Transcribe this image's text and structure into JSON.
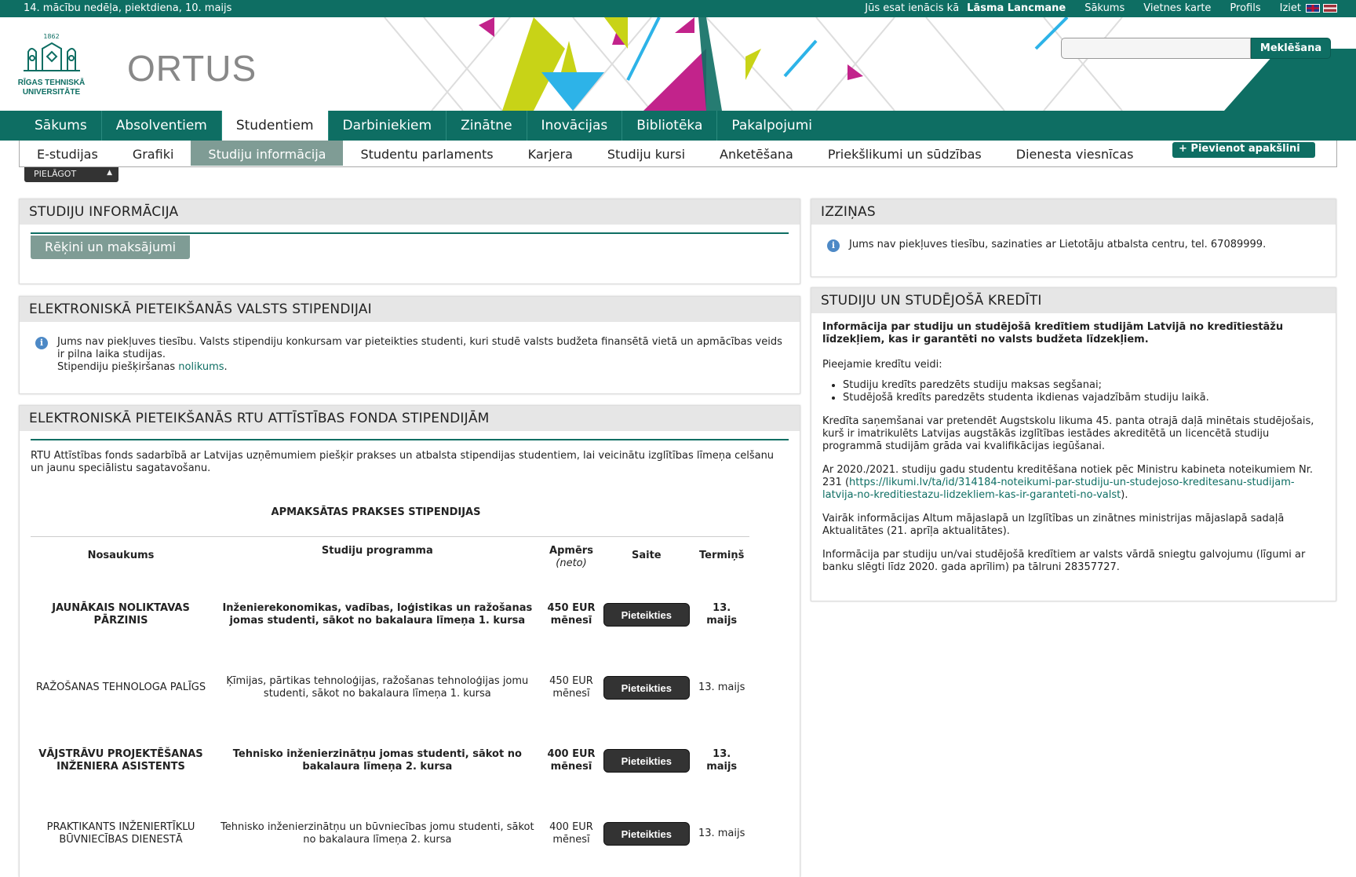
{
  "topbar": {
    "week_info": "14. mācību nedēļa, piektdiena, 10. maijs",
    "logged_in_prefix": "Jūs esat ienācis kā",
    "user_name": "Lāsma Lancmane",
    "links": [
      "Sākums",
      "Vietnes karte",
      "Profils",
      "Iziet"
    ]
  },
  "header": {
    "logo_year": "1862",
    "logo_name_line1": "RĪGAS TEHNISKĀ",
    "logo_name_line2": "UNIVERSITĀTE",
    "portal_name": "ORTUS",
    "search_placeholder": "",
    "search_button": "Meklēšana"
  },
  "main_nav": [
    "Sākums",
    "Absolventiem",
    "Studentiem",
    "Darbiniekiem",
    "Zinātne",
    "Inovācijas",
    "Bibliotēka",
    "Pakalpojumi"
  ],
  "main_nav_active": "Studentiem",
  "sub_nav": [
    "E-studijas",
    "Grafiki",
    "Studiju informācija",
    "Studentu parlaments",
    "Karjera",
    "Studiju kursi",
    "Anketēšana",
    "Priekšlikumi un sūdzības",
    "Dienesta viesnīcas"
  ],
  "sub_nav_active": "Studiju informācija",
  "add_sublink_label": "Pievienot apakšlini",
  "customize_label": "PIELĀGOT",
  "panel_study_info": {
    "title": "STUDIJU INFORMĀCIJA",
    "button": "Rēķini un maksājumi"
  },
  "panel_state_scholarship": {
    "title": "ELEKTRONISKĀ PIETEIKŠANĀS VALSTS STIPENDIJAI",
    "text": "Jums nav piekļuves tiesību. Valsts stipendiju konkursam var pieteikties studenti, kuri studē valsts budžeta finansētā vietā un apmācības veids ir pilna laika studijas.",
    "rules_prefix": "Stipendiju piešķiršanas",
    "rules_link": "nolikums",
    "rules_suffix": "."
  },
  "panel_rtu_fund": {
    "title": "ELEKTRONISKĀ PIETEIKŠANĀS RTU ATTĪSTĪBAS FONDA STIPENDIJĀM",
    "intro": "RTU Attīstības fonds sadarbībā ar Latvijas uzņēmumiem piešķir prakses un atbalsta stipendijas studentiem, lai veicinātu izglītības līmeņa celšanu un jaunu speciālistu sagatavošanu.",
    "table_title": "APMAKSĀTAS PRAKSES STIPENDIJAS",
    "columns": {
      "name": "Nosaukums",
      "program": "Studiju programma",
      "amount_line1": "Apmērs",
      "amount_line2": "(neto)",
      "link": "Saite",
      "deadline": "Termiņš"
    },
    "rows": [
      {
        "name": "JAUNĀKAIS NOLIKTAVAS PĀRZINIS",
        "program": "Inženierekonomikas, vadības, loģistikas un ražošanas jomas studenti, sākot no bakalaura līmeņa 1. kursa",
        "amount": "450 EUR mēnesī",
        "button": "Pieteikties",
        "deadline": "13. maijs",
        "bold": true
      },
      {
        "name": "RAŽOŠANAS TEHNOLOGA PALĪGS",
        "program": "Ķīmijas, pārtikas tehnoloģijas, ražošanas tehnoloģijas jomu studenti, sākot no bakalaura līmeņa 1. kursa",
        "amount": "450 EUR mēnesī",
        "button": "Pieteikties",
        "deadline": "13. maijs",
        "bold": false
      },
      {
        "name": "VĀJSTRĀVU PROJEKTĒŠANAS INŽENIERA ASISTENTS",
        "program": "Tehnisko inženierzinātņu jomas studenti, sākot no bakalaura līmeņa 2. kursa",
        "amount": "400 EUR mēnesī",
        "button": "Pieteikties",
        "deadline": "13. maijs",
        "bold": true
      },
      {
        "name": "PRAKTIKANTS INŽENIERTĪKLU BŪVNIECĪBAS DIENESTĀ",
        "program": "Tehnisko inženierzinātņu un būvniecības jomu studenti, sākot no bakalaura līmeņa 2. kursa",
        "amount": "400 EUR mēnesī",
        "button": "Pieteikties",
        "deadline": "13. maijs",
        "bold": false
      }
    ]
  },
  "panel_certificates": {
    "title": "IZZIŅAS",
    "text": "Jums nav piekļuves tiesību, sazinaties ar Lietotāju atbalsta centru, tel. 67089999."
  },
  "panel_loans": {
    "title": "STUDIJU UN STUDĒJOŠĀ KREDĪTI",
    "lead": "Informācija par studiju un studējošā kredītiem studijām Latvijā no kredītiestāžu līdzekļiem, kas ir garantēti no valsts budžeta līdzekļiem.",
    "types_heading": "Pieejamie kredītu veidi:",
    "types": [
      "Studiju kredīts paredzēts studiju maksas segšanai;",
      "Studējošā kredīts paredzēts studenta ikdienas vajadzībām studiju laikā."
    ],
    "eligibility": "Kredīta saņemšanai var pretendēt Augstskolu likuma 45. panta otrajā daļā minētais studējošais, kurš ir imatrikulēts Latvijas augstākās izglītības iestādes akreditētā un licencētā studiju programmā studijām grāda vai kvalifikācijas iegūšanai.",
    "regulation_prefix": "Ar 2020./2021. studiju gadu studentu kreditēšana notiek pēc Ministru kabineta noteikumiem Nr. 231 (",
    "regulation_link": "https://likumi.lv/ta/id/314184-noteikumi-par-studiju-un-studejoso-kreditesanu-studijam-latvija-no-kreditiestazu-lidzekliem-kas-ir-garanteti-no-valst",
    "regulation_suffix": ").",
    "more_info": "Vairāk informācijas Altum mājaslapā un Izglītības un zinātnes ministrijas mājaslapā sadaļā Aktualitātes (21. aprīļa aktualitātes).",
    "phone_info": "Informācija par studiju un/vai studējošā kredītiem ar valsts vārdā sniegtu galvojumu (līgumi ar banku slēgti līdz 2020. gada aprīlim) pa tālruni 28357727."
  },
  "colors": {
    "brand": "#0e6e63",
    "tab_active": "#7f9c95",
    "panel_header": "#e6e6e6",
    "button_dark": "#333333",
    "info_icon": "#4d89c6"
  }
}
